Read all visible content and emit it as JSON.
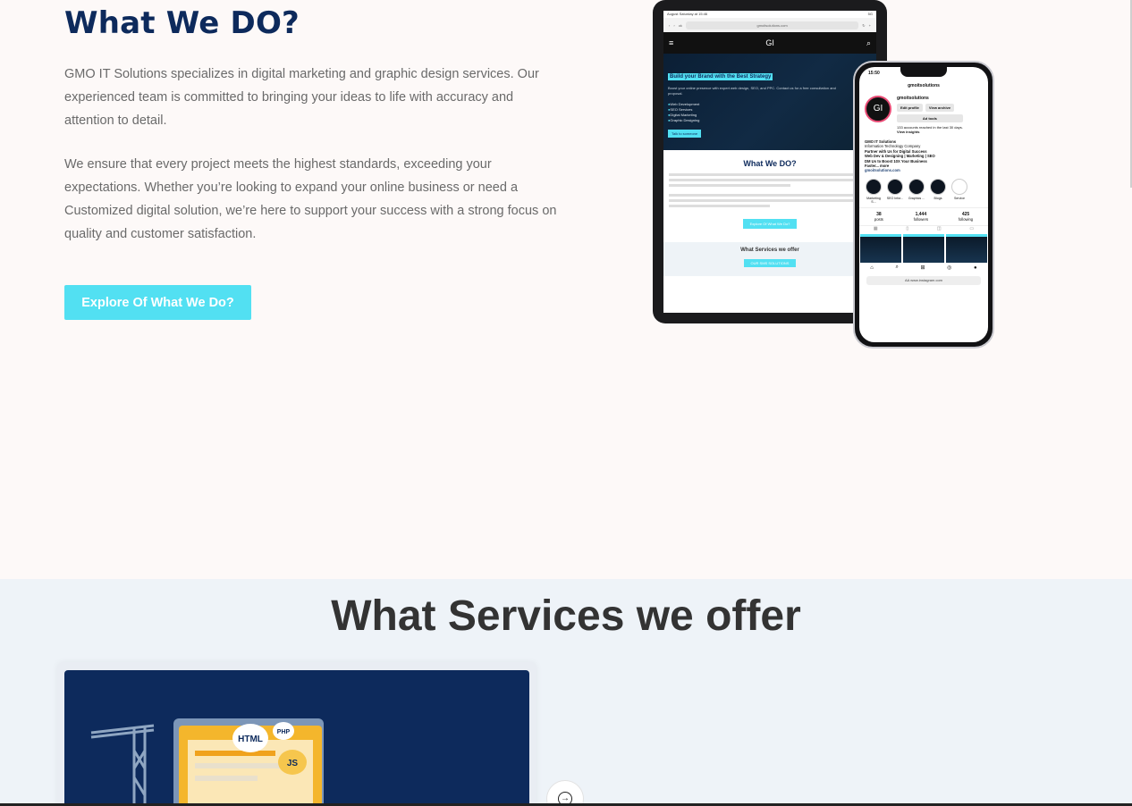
{
  "about": {
    "title": "What We DO?",
    "paragraph1": "GMO IT Solutions specializes in digital marketing and graphic design services. Our experienced team is committed to bringing your ideas to life with accuracy and attention to detail.",
    "paragraph2": "We ensure that every project meets the highest standards, exceeding your expectations. Whether you’re looking to expand your online business or need a Customized digital solution, we’re here to support your success with a strong focus on quality and customer satisfaction.",
    "cta_label": "Explore Of What We Do?"
  },
  "tablet": {
    "status_left": "August Saturday at 15:46",
    "status_right": "5G",
    "url_tab": "ok",
    "url": "gmoitsolutions.com",
    "logo": "GI",
    "hero_title": "Build your Brand with the Best Strategy",
    "hero_sub": "Boost your online presence with expert web design, SEO, and PPC. Contact us for a free consultation and proposal.",
    "hero_list": [
      "Web Development",
      "SEO Services",
      "Digital Marketing",
      "Graphic Designing"
    ],
    "hero_btn": "Talk to someone",
    "section_title": "What We DO?",
    "section_btn": "Explore Of What We Do?",
    "services_title": "What Services we offer",
    "services_btn": "OUR SMS SOLUTIONS"
  },
  "phone": {
    "time": "15:50",
    "username": "gmoitsolutions",
    "avatar_text": "GI",
    "edit_profile": "Edit profile",
    "view_archive": "View archive",
    "ad_tools": "Ad tools",
    "reach": "133 accounts reached in the last 30 days.",
    "insights": "View insights",
    "bio_name": "GMO IT Solutions",
    "bio_category": "Information Technology Company",
    "bio_line1": "Partner with Us for Digital Success",
    "bio_line2": "Web Dev & Designing | Marketing | SEO",
    "bio_line3": "DM Us to Boost 10X Your Business",
    "bio_more": "Faster... more",
    "bio_link": "gmoitsolutions.com",
    "highlights": [
      "Marketing S...",
      "SEO Infor...",
      "Graphics ...",
      "Blogs",
      "Service"
    ],
    "stats": [
      {
        "value": "38",
        "label": "posts"
      },
      {
        "value": "1,444",
        "label": "followers"
      },
      {
        "value": "425",
        "label": "following"
      }
    ],
    "url": "www.instagram.com",
    "url_prefix": "AA"
  },
  "services": {
    "title": "What Services we offer",
    "card_labels": [
      "HTML",
      "PHP",
      "JS"
    ]
  },
  "colors": {
    "navy": "#0d2a5c",
    "accent": "#52e0f2",
    "section_bg": "#eef3f8",
    "page_bg": "#fdf9f8"
  },
  "icons": [
    "arrow-right-circle-icon",
    "menu-icon",
    "search-icon",
    "home-icon"
  ]
}
